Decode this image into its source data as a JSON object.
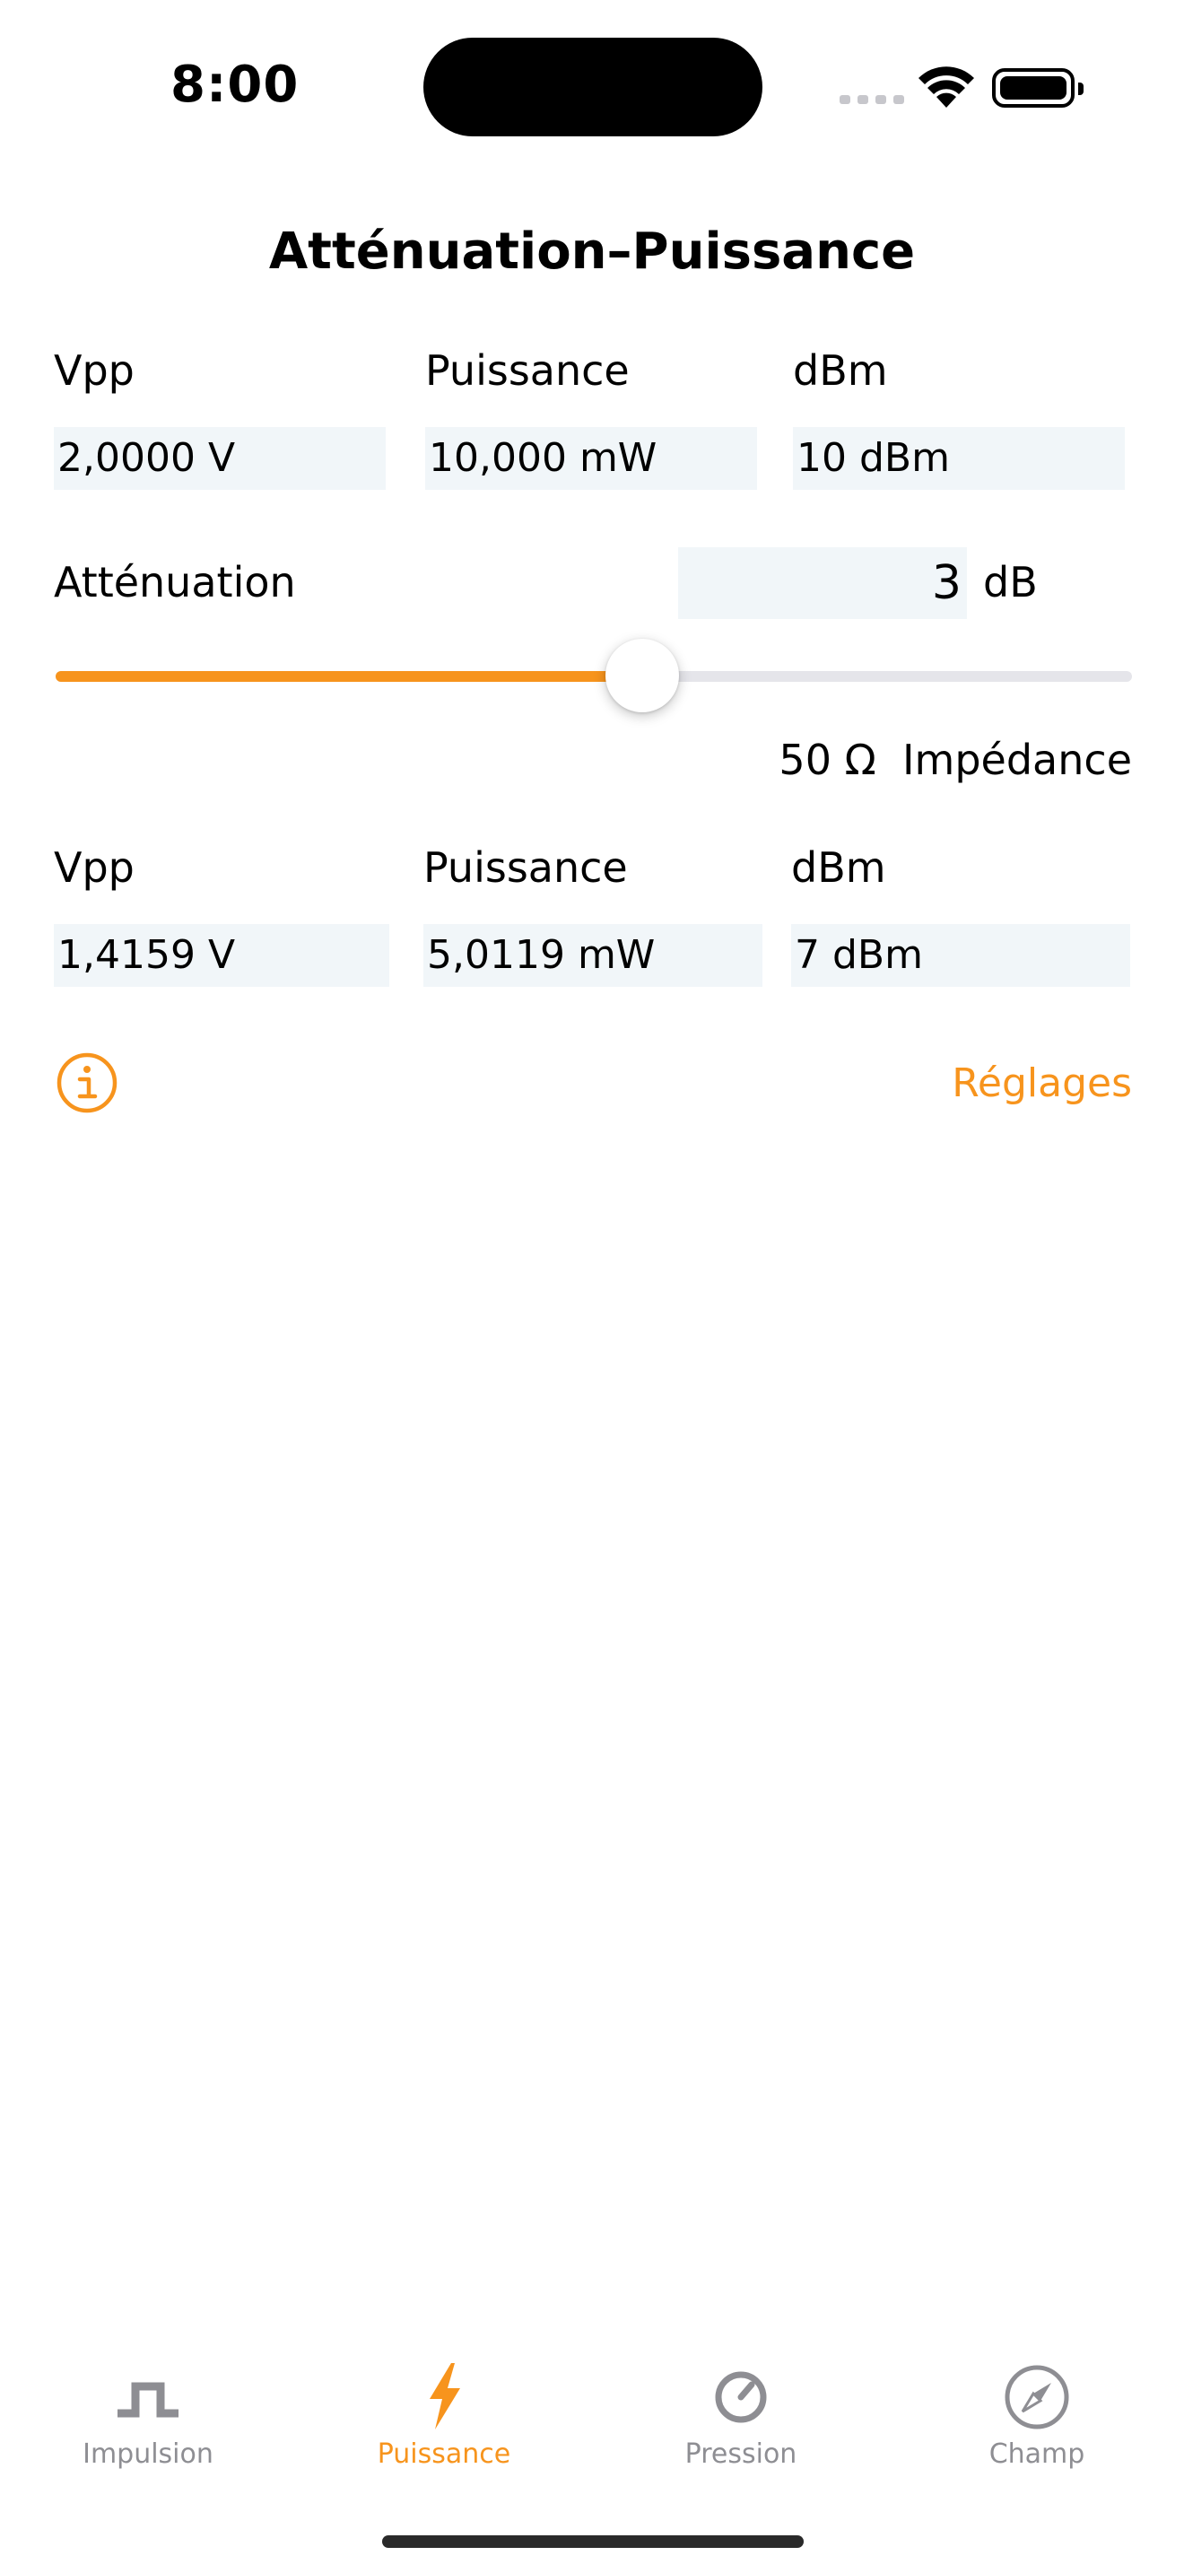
{
  "status": {
    "time": "8:00"
  },
  "title": "Atténuation–Puissance",
  "input": {
    "vpp_label": "Vpp",
    "power_label": "Puissance",
    "dbm_label": "dBm",
    "vpp_value": "2,0000 V",
    "power_value": "10,000 mW",
    "dbm_value": "10 dBm"
  },
  "attenuation": {
    "label": "Atténuation",
    "value": "3",
    "unit": "dB",
    "slider_fraction": 0.545
  },
  "impedance": {
    "value": "50 Ω",
    "label": "Impédance"
  },
  "output": {
    "vpp_label": "Vpp",
    "power_label": "Puissance",
    "dbm_label": "dBm",
    "vpp_value": "1,4159 V",
    "power_value": "5,0119 mW",
    "dbm_value": "7 dBm"
  },
  "footer": {
    "settings_label": "Réglages",
    "info_icon": "info-icon"
  },
  "tabs": [
    {
      "label": "Impulsion",
      "icon": "pulse-icon",
      "active": false
    },
    {
      "label": "Puissance",
      "icon": "bolt-icon",
      "active": true
    },
    {
      "label": "Pression",
      "icon": "gauge-icon",
      "active": false
    },
    {
      "label": "Champ",
      "icon": "compass-icon",
      "active": false
    }
  ],
  "colors": {
    "accent": "#f7941d",
    "field_bg": "#f1f6f9",
    "inactive": "#8e8e93"
  }
}
